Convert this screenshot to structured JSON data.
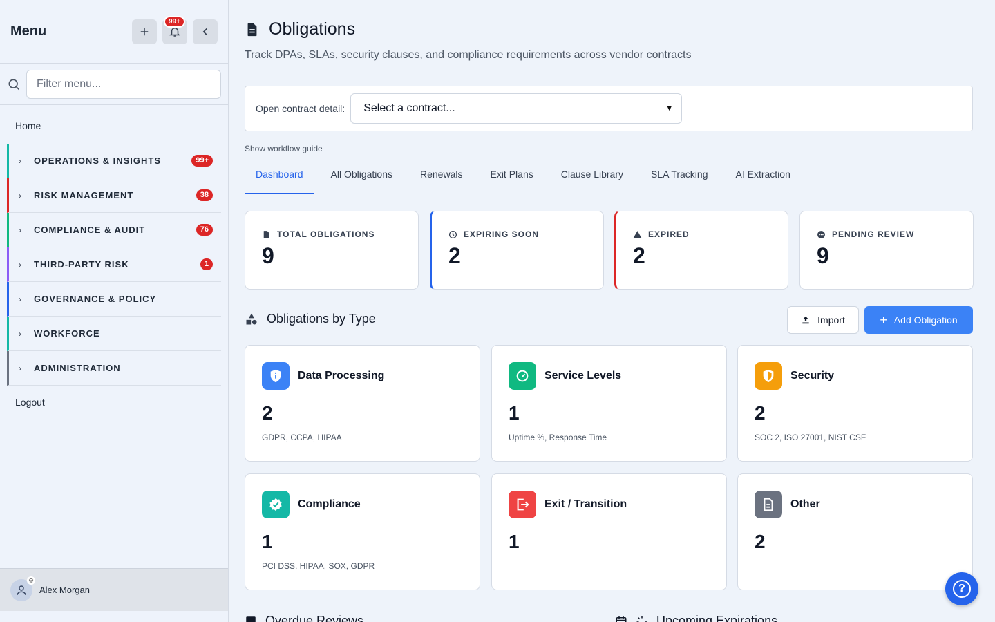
{
  "sidebar": {
    "title": "Menu",
    "notification_count": "99+",
    "filter_placeholder": "Filter menu...",
    "home": "Home",
    "items": [
      {
        "label": "OPERATIONS & INSIGHTS",
        "badge": "99+",
        "color": "#14b8a6"
      },
      {
        "label": "RISK MANAGEMENT",
        "badge": "38",
        "color": "#dc2626"
      },
      {
        "label": "COMPLIANCE & AUDIT",
        "badge": "76",
        "color": "#10b981"
      },
      {
        "label": "THIRD-PARTY RISK",
        "badge": "1",
        "color": "#8b5cf6"
      },
      {
        "label": "GOVERNANCE & POLICY",
        "badge": "",
        "color": "#2563eb"
      },
      {
        "label": "WORKFORCE",
        "badge": "",
        "color": "#14b8a6"
      },
      {
        "label": "ADMINISTRATION",
        "badge": "",
        "color": "#6b7280"
      }
    ],
    "logout": "Logout",
    "user_name": "Alex Morgan"
  },
  "main": {
    "title": "Obligations",
    "subtitle": "Track DPAs, SLAs, security clauses, and compliance requirements across vendor contracts",
    "contract_label": "Open contract detail:",
    "contract_select": "Select a contract...",
    "guide": "Show workflow guide",
    "tabs": [
      "Dashboard",
      "All Obligations",
      "Renewals",
      "Exit Plans",
      "Clause Library",
      "SLA Tracking",
      "AI Extraction"
    ],
    "stats": [
      {
        "label": "TOTAL OBLIGATIONS",
        "value": "9"
      },
      {
        "label": "EXPIRING SOON",
        "value": "2"
      },
      {
        "label": "EXPIRED",
        "value": "2"
      },
      {
        "label": "PENDING REVIEW",
        "value": "9"
      }
    ],
    "section_title": "Obligations by Type",
    "import_label": "Import",
    "add_label": "Add Obligation",
    "cards": [
      {
        "name": "Data Processing",
        "count": "2",
        "desc": "GDPR, CCPA, HIPAA",
        "color": "#3b82f6"
      },
      {
        "name": "Service Levels",
        "count": "1",
        "desc": "Uptime %, Response Time",
        "color": "#10b981"
      },
      {
        "name": "Security",
        "count": "2",
        "desc": "SOC 2, ISO 27001, NIST CSF",
        "color": "#f59e0b"
      },
      {
        "name": "Compliance",
        "count": "1",
        "desc": "PCI DSS, HIPAA, SOX, GDPR",
        "color": "#14b8a6"
      },
      {
        "name": "Exit / Transition",
        "count": "1",
        "desc": "",
        "color": "#ef4444"
      },
      {
        "name": "Other",
        "count": "2",
        "desc": "",
        "color": "#6b7280"
      }
    ],
    "overdue_title": "Overdue Reviews",
    "upcoming_title": "Upcoming Expirations"
  },
  "colors": {
    "accent": "#2563eb",
    "primary_button": "#3b82f6",
    "badge": "#dc2626"
  }
}
